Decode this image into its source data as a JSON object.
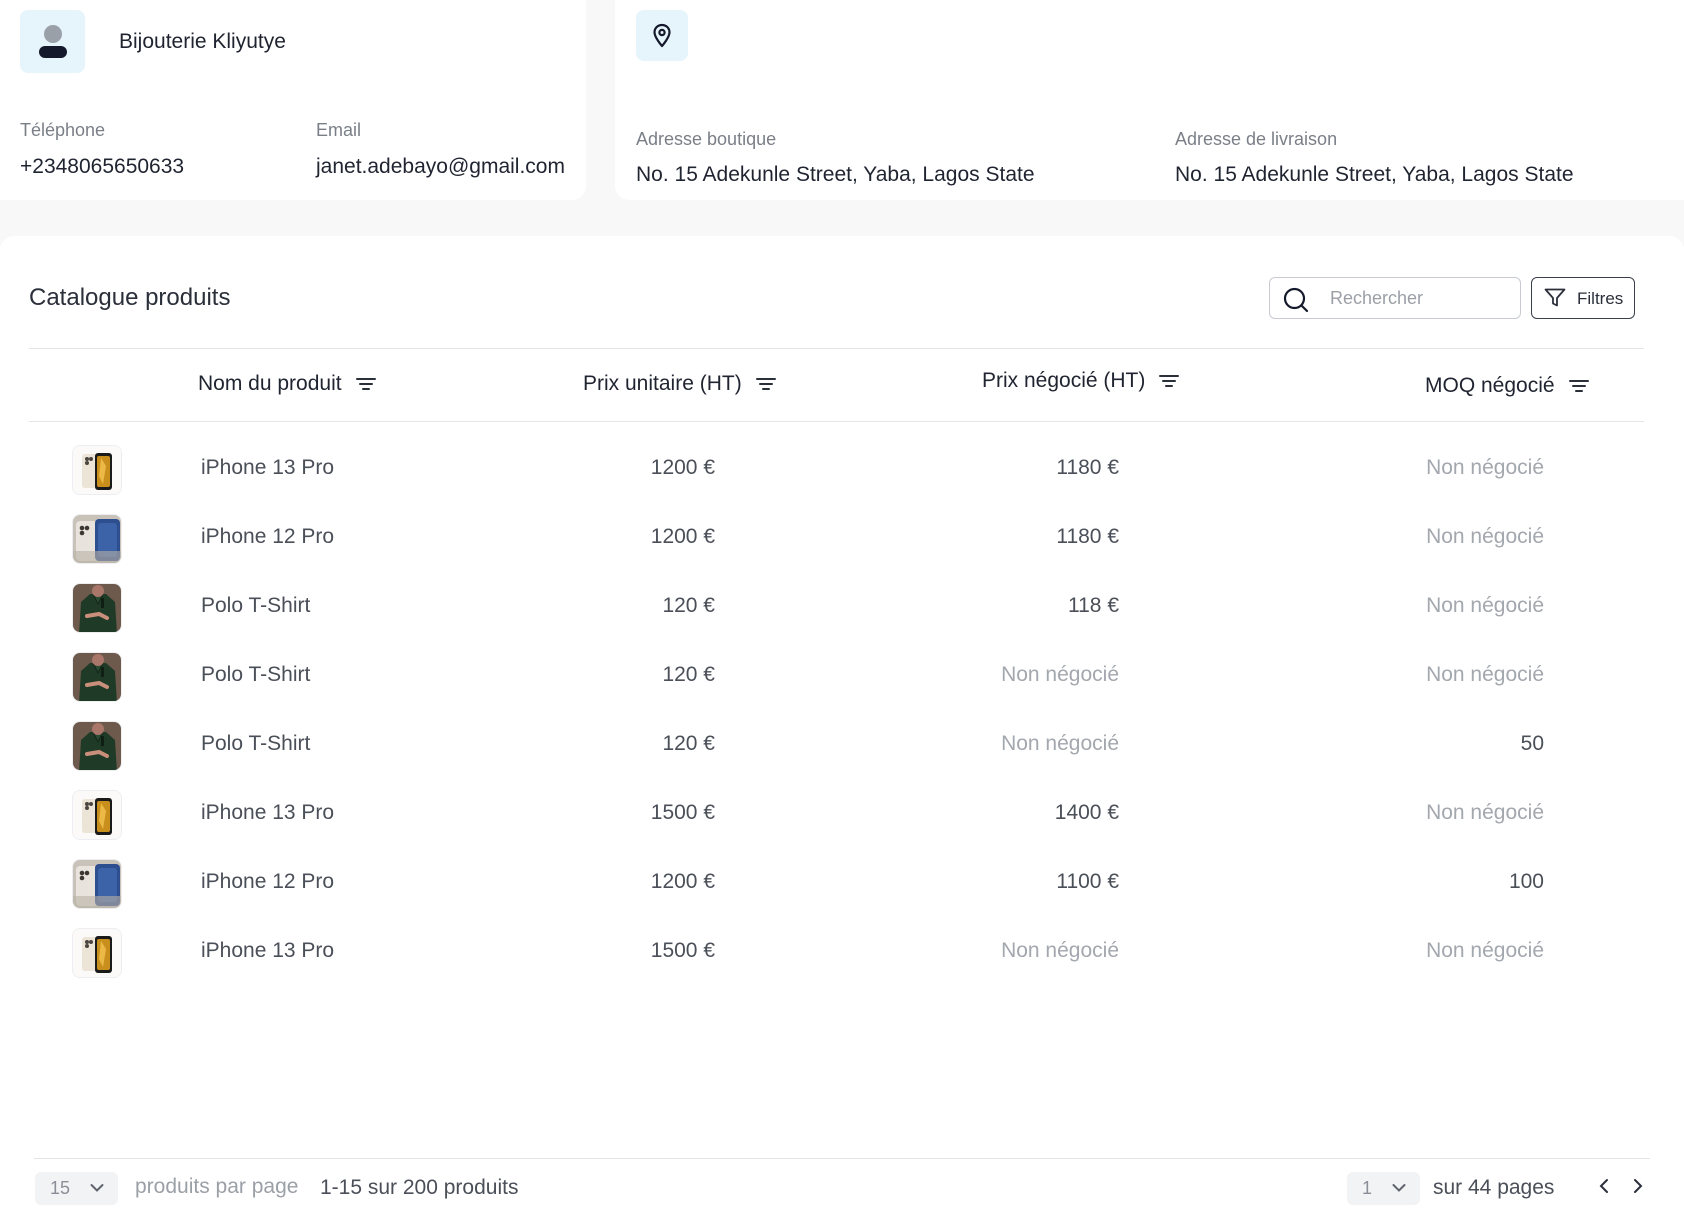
{
  "contact": {
    "shop_name": "Bijouterie Kliyutye",
    "phone_label": "Téléphone",
    "phone_value": "+2348065650633",
    "email_label": "Email",
    "email_value": "janet.adebayo@gmail.com"
  },
  "address": {
    "shop_label": "Adresse boutique",
    "shop_value": "No. 15 Adekunle Street, Yaba, Lagos State",
    "delivery_label": "Adresse de livraison",
    "delivery_value": "No. 15 Adekunle Street, Yaba, Lagos State"
  },
  "catalogue": {
    "title": "Catalogue produits",
    "search_placeholder": "Rechercher",
    "filter_label": "Filtres",
    "columns": {
      "name": "Nom du produit",
      "unit_price": "Prix unitaire (HT)",
      "negotiated_price": "Prix négocié (HT)",
      "moq": "MOQ négocié"
    },
    "rows": [
      {
        "image": "iphone-13-pro",
        "name": "iPhone 13 Pro",
        "unit_price": "1200 €",
        "negotiated_price": "1180 €",
        "moq": "Non négocié"
      },
      {
        "image": "iphone-12-pro",
        "name": "iPhone 12 Pro",
        "unit_price": "1200 €",
        "negotiated_price": "1180 €",
        "moq": "Non négocié"
      },
      {
        "image": "polo-tshirt",
        "name": "Polo T-Shirt",
        "unit_price": "120 €",
        "negotiated_price": "118 €",
        "moq": "Non négocié"
      },
      {
        "image": "polo-tshirt",
        "name": "Polo T-Shirt",
        "unit_price": "120 €",
        "negotiated_price": "Non négocié",
        "moq": "Non négocié"
      },
      {
        "image": "polo-tshirt",
        "name": "Polo T-Shirt",
        "unit_price": "120 €",
        "negotiated_price": "Non négocié",
        "moq": "50"
      },
      {
        "image": "iphone-13-pro",
        "name": "iPhone 13 Pro",
        "unit_price": "1500 €",
        "negotiated_price": "1400 €",
        "moq": "Non négocié"
      },
      {
        "image": "iphone-12-pro",
        "name": "iPhone 12 Pro",
        "unit_price": "1200 €",
        "negotiated_price": "1100 €",
        "moq": "100"
      },
      {
        "image": "iphone-13-pro",
        "name": "iPhone 13 Pro",
        "unit_price": "1500 €",
        "negotiated_price": "Non négocié",
        "moq": "Non négocié"
      }
    ],
    "not_negotiated_text": "Non négocié"
  },
  "pagination": {
    "per_page_value": "15",
    "per_page_label": "produits par page",
    "range_text": "1-15 sur 200 produits",
    "page_value": "1",
    "pages_text": "sur 44 pages"
  },
  "colors": {
    "icon_bg": "#e6f4fb",
    "muted_text": "#a3a7ae",
    "border": "#e3e5e8"
  }
}
